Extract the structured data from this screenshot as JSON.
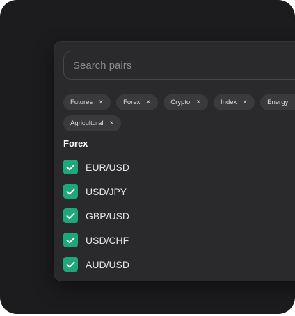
{
  "search": {
    "placeholder": "Search pairs",
    "value": ""
  },
  "filters": [
    {
      "label": "Futures"
    },
    {
      "label": "Forex"
    },
    {
      "label": "Crypto"
    },
    {
      "label": "Index"
    },
    {
      "label": "Energy"
    },
    {
      "label": "Agricultural"
    }
  ],
  "filter_remove_glyph": "×",
  "section": {
    "title": "Forex",
    "items": [
      {
        "label": "EUR/USD",
        "checked": true
      },
      {
        "label": "USD/JPY",
        "checked": true
      },
      {
        "label": "GBP/USD",
        "checked": true
      },
      {
        "label": "USD/CHF",
        "checked": true
      },
      {
        "label": "AUD/USD",
        "checked": true
      }
    ]
  },
  "colors": {
    "accent": "#1fa67a",
    "panel": "#2a2a2c",
    "background": "#1c1c1e",
    "chip": "#3a3a3d"
  },
  "icons": {
    "search": "search-icon",
    "check": "check-icon",
    "remove": "close-icon"
  }
}
